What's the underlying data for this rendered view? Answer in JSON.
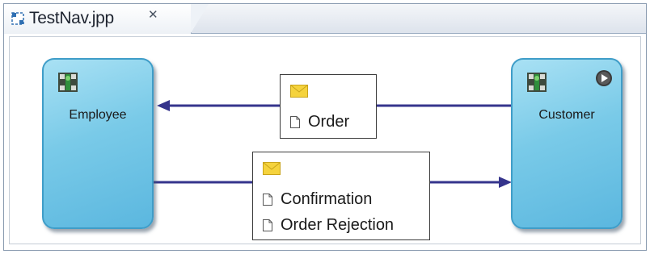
{
  "tab": {
    "title": "TestNav.jpp",
    "close_glyph": "✕",
    "icon": "diagram-file-icon"
  },
  "nodes": {
    "employee": {
      "label": "Employee",
      "icon": "role-icon"
    },
    "customer": {
      "label": "Customer",
      "icon": "role-icon",
      "badge_icon": "run-icon"
    }
  },
  "messages": {
    "order": {
      "icon": "envelope-icon",
      "items": [
        "Order"
      ]
    },
    "reply": {
      "icon": "envelope-icon",
      "items": [
        "Confirmation",
        "Order Rejection"
      ]
    }
  },
  "colors": {
    "node_fill": "#79cae8",
    "node_border": "#3f9dc8",
    "connector": "#35348c",
    "envelope": "#f5d33d"
  }
}
